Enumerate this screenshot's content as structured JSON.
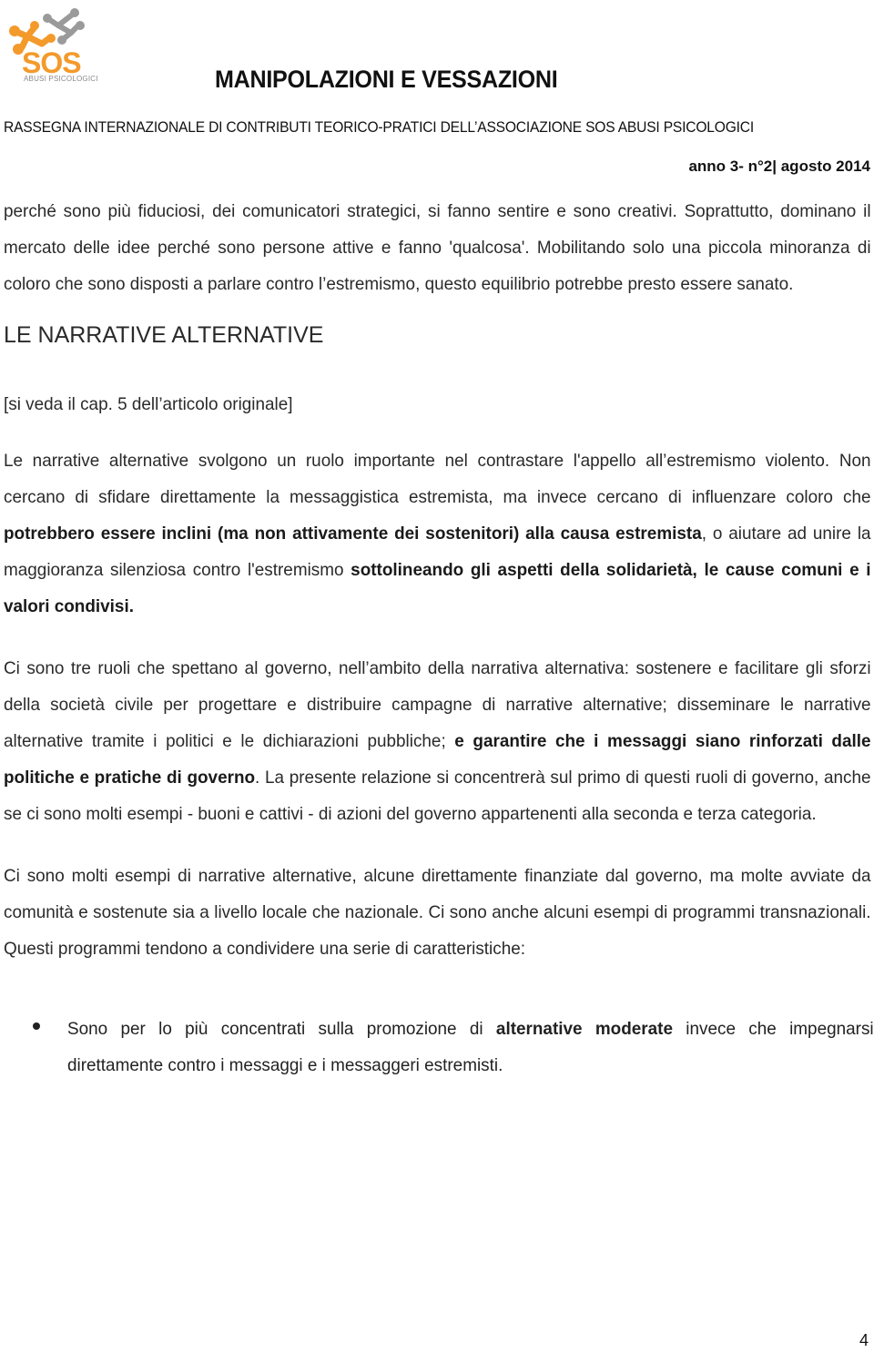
{
  "header": {
    "logo": {
      "icon": "sos-molecule-logo-icon",
      "brand_text": "SOS",
      "caption": "ABUSI PSICOLOGICI",
      "colors": {
        "orange": "#f39a2b",
        "grey": "#9a9a9a"
      }
    },
    "title": "MANIPOLAZIONI E VESSAZIONI",
    "subtitle": "RASSEGNA INTERNAZIONALE DI CONTRIBUTI TEORICO-PRATICI DELL’ASSOCIAZIONE SOS ABUSI PSICOLOGICI",
    "issue": "anno 3- n°2| agosto 2014"
  },
  "body": {
    "intro_paragraph": "perché sono  più fiduciosi, dei comunicatori strategici, si fanno sentire e sono creativi. Soprattutto, dominano il mercato delle idee perché sono persone attive e fanno 'qualcosa'. Mobilitando solo una piccola minoranza di coloro che sono disposti a parlare contro l’estremismo, questo equilibrio potrebbe presto essere sanato.",
    "section_heading": "LE NARRATIVE ALTERNATIVE",
    "note": "[si veda il cap. 5 dell’articolo originale]",
    "paragraph_1": {
      "part_1": "Le narrative alternative svolgono un ruolo importante nel contrastare l'appello all’estremismo violento. Non cercano di sfidare direttamente la messaggistica estremista, ma invece cercano di influenzare coloro che ",
      "bold_1": "potrebbero essere inclini (ma non attivamente dei sostenitori) alla causa estremista",
      "part_2": ", o aiutare ad unire la maggioranza silenziosa contro l'estremismo ",
      "bold_2": "sottolineando gli aspetti della solidarietà, le cause comuni e i valori condivisi."
    },
    "paragraph_2": {
      "part_1": "Ci sono tre ruoli che spettano al governo, nell’ambito della narrativa alternativa: sostenere e facilitare gli sforzi della società civile per progettare e distribuire campagne di narrative alternative; disseminare le narrative alternative tramite i politici e le dichiarazioni pubbliche; ",
      "bold_1": "e garantire che i messaggi siano rinforzati dalle politiche e pratiche di governo",
      "part_2": ". La presente relazione si concentrerà sul primo di questi ruoli di governo, anche se ci sono molti esempi - buoni e cattivi - di azioni del governo appartenenti alla seconda e terza categoria."
    },
    "paragraph_3": "Ci sono molti esempi di narrative alternative, alcune direttamente finanziate dal governo, ma molte avviate da comunità e sostenute sia a livello locale che  nazionale. Ci sono anche alcuni esempi di programmi transnazionali. Questi programmi tendono a condividere una serie di caratteristiche:",
    "bullets": [
      {
        "part_1": "Sono per lo più concentrati sulla promozione di ",
        "bold_1": "alternative moderate",
        "part_2": " invece che impegnarsi direttamente contro i messaggi e i messaggeri estremisti."
      }
    ]
  },
  "footer": {
    "page_number": "4"
  }
}
